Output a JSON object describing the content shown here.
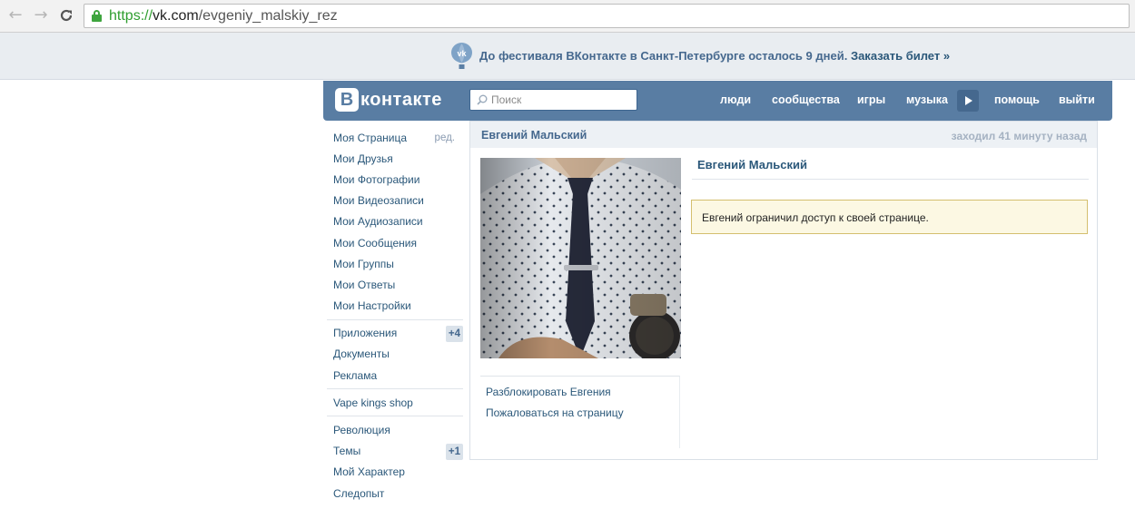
{
  "browser": {
    "url_scheme": "https://",
    "url_host": "vk.com",
    "url_path": "/evgeniy_malskiy_rez"
  },
  "banner": {
    "text": "До фестиваля ВКонтакте в Санкт-Петербурге осталось 9 дней.",
    "link": "Заказать билет »"
  },
  "header": {
    "logo_letter": "В",
    "logo_text": "контакте",
    "search_placeholder": "Поиск",
    "nav": [
      "люди",
      "сообщества",
      "игры",
      "музыка",
      "помощь",
      "выйти"
    ]
  },
  "left_menu": {
    "main": [
      {
        "label": "Моя Страница",
        "edit": "ред."
      },
      {
        "label": "Мои Друзья"
      },
      {
        "label": "Мои Фотографии"
      },
      {
        "label": "Мои Видеозаписи"
      },
      {
        "label": "Мои Аудиозаписи"
      },
      {
        "label": "Мои Сообщения"
      },
      {
        "label": "Мои Группы"
      },
      {
        "label": "Мои Ответы"
      },
      {
        "label": "Мои Настройки"
      }
    ],
    "apps": [
      {
        "label": "Приложения",
        "badge": "+4"
      },
      {
        "label": "Документы"
      },
      {
        "label": "Реклама"
      }
    ],
    "groups1": [
      {
        "label": "Vape kings shop"
      }
    ],
    "groups2": [
      {
        "label": "Революция"
      },
      {
        "label": "Темы",
        "badge": "+1"
      },
      {
        "label": "Мой Характер"
      },
      {
        "label": "Следопыт"
      }
    ]
  },
  "profile": {
    "name": "Евгений Мальский",
    "last_seen": "заходил 41 минуту назад",
    "actions": [
      "Разблокировать Евгения",
      "Пожаловаться на страницу"
    ],
    "restricted_message": "Евгений ограничил доступ к своей странице."
  },
  "colors": {
    "header_blue": "#597da3",
    "link_blue": "#2b587a",
    "banner_bg": "#e9edf1",
    "notice_bg": "#fcf8e3"
  }
}
